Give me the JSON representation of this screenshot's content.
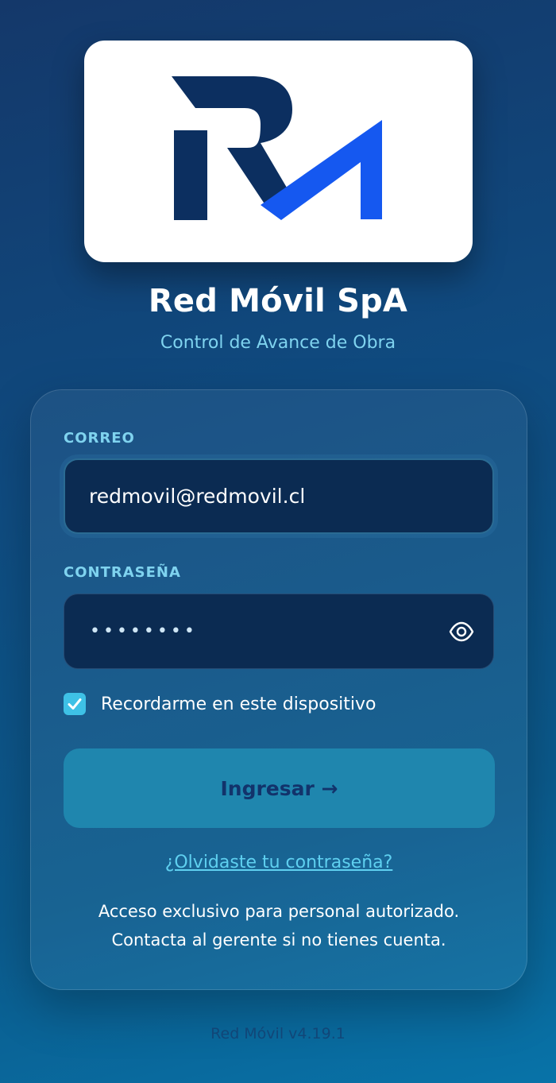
{
  "brand": {
    "title": "Red Móvil SpA",
    "subtitle": "Control de Avance de Obra",
    "logo_icon": "rm-logo",
    "logo_colors": {
      "dark": "#0c2f60",
      "accent": "#1558f0"
    }
  },
  "form": {
    "email_label": "CORREO",
    "email_value": "redmovil@redmovil.cl",
    "password_label": "CONTRASEÑA",
    "password_mask": "••••••••",
    "password_icon": "eye-icon",
    "remember_label": "Recordarme en este dispositivo",
    "remember_checked": true,
    "submit_label": "Ingresar →",
    "forgot_label": "¿Olvidaste tu contraseña?"
  },
  "notice": {
    "line1": "Acceso exclusivo para personal autorizado.",
    "line2": "Contacta al gerente si no tienes cuenta."
  },
  "footer": {
    "version": "Red Móvil v4.19.1"
  },
  "colors": {
    "accent_text": "#7fd3ef",
    "button_bg": "#1f86ae",
    "button_text": "#12336b",
    "checkbox": "#3ec1e6"
  }
}
